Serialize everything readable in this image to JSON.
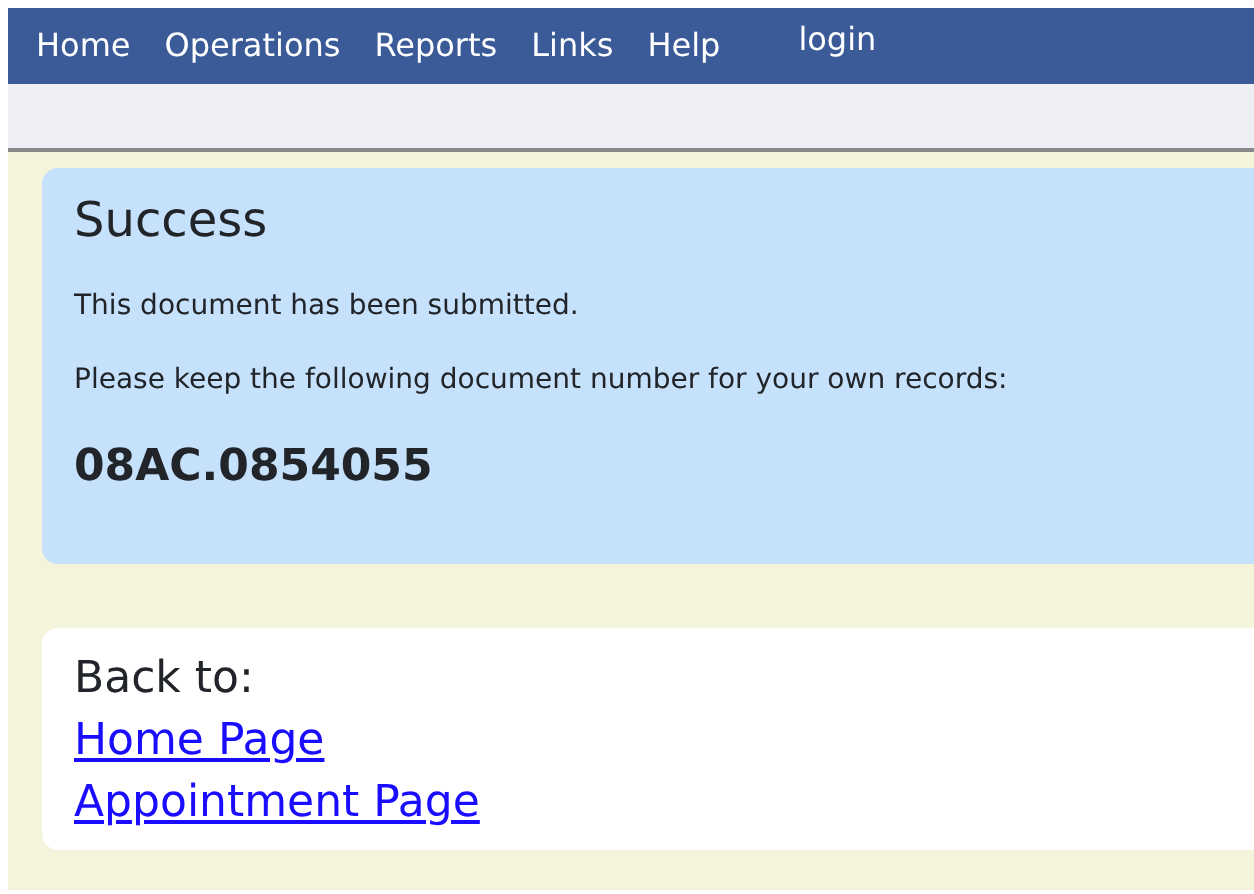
{
  "menu": [
    {
      "label": "Home"
    },
    {
      "label": "Operations"
    },
    {
      "label": "Reports"
    },
    {
      "label": "Links"
    },
    {
      "label": "Help"
    }
  ],
  "login": "login",
  "alert": {
    "title": "Success",
    "message": "This document has been submitted.",
    "instruction": "Please keep the following document number for your own records:",
    "document_number": "08AC.0854055"
  },
  "back": {
    "label": "Back to:",
    "links": [
      {
        "label": "Home Page"
      },
      {
        "label": "Appointment Page"
      }
    ]
  }
}
